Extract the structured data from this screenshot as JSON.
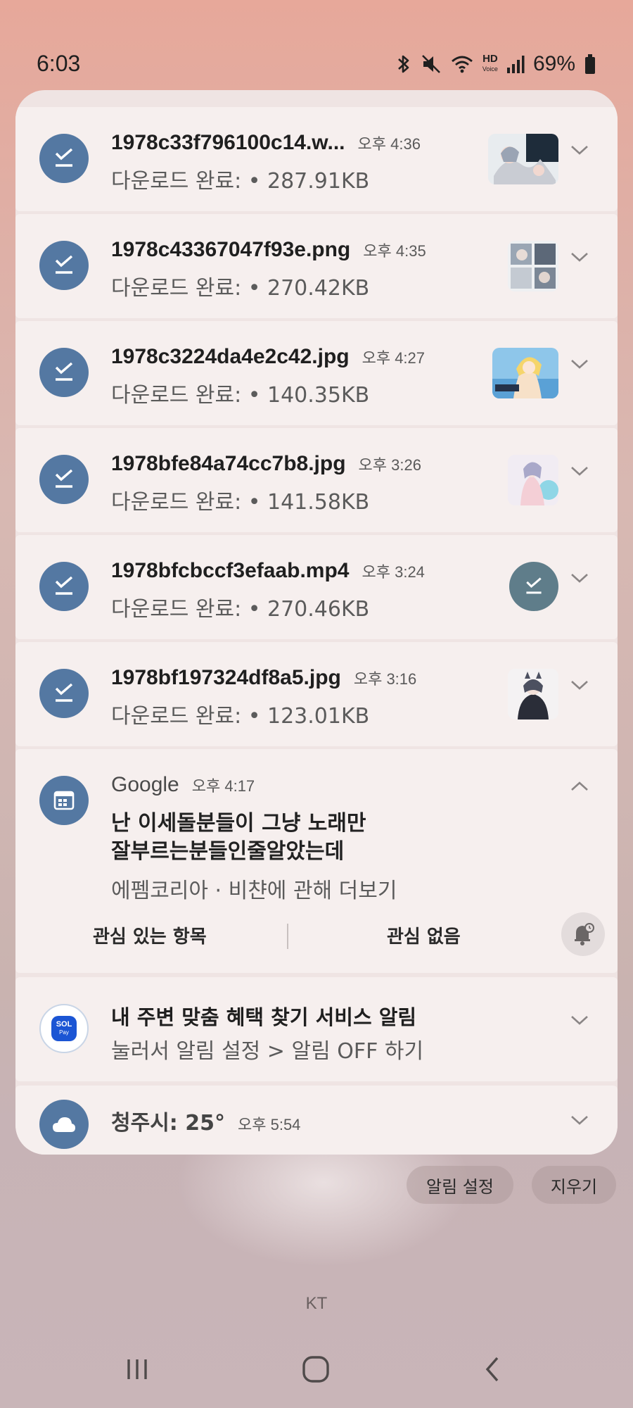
{
  "status_bar": {
    "time": "6:03",
    "battery_percent": "69%",
    "hd_label": "HD",
    "hd_sub": "Voice",
    "icons": [
      "bluetooth-icon",
      "mute-icon",
      "wifi-icon",
      "hd-voice-icon",
      "signal-icon",
      "battery-icon"
    ]
  },
  "downloads": [
    {
      "title": "1978c33f796100c14.w...",
      "time": "오후 4:36",
      "status": "다운로드 완료: • 287.91KB",
      "thumb": "manga-image"
    },
    {
      "title": "1978c43367047f93e.png",
      "time": "오후 4:35",
      "status": "다운로드 완료: • 270.42KB",
      "thumb": "manga-image"
    },
    {
      "title": "1978c3224da4e2c42.jpg",
      "time": "오후 4:27",
      "status": "다운로드 완료: • 140.35KB",
      "thumb": "game-art-image"
    },
    {
      "title": "1978bfe84a74cc7b8.jpg",
      "time": "오후 3:26",
      "status": "다운로드 완료: • 141.58KB",
      "thumb": "anime-image"
    },
    {
      "title": "1978bfcbccf3efaab.mp4",
      "time": "오후 3:24",
      "status": "다운로드 완료: • 270.46KB",
      "thumb": "download-done-icon"
    },
    {
      "title": "1978bf197324df8a5.jpg",
      "time": "오후 3:16",
      "status": "다운로드 완료: • 123.01KB",
      "thumb": "anime-image"
    }
  ],
  "google": {
    "app": "Google",
    "time": "오후 4:17",
    "line1": "난 이세돌분들이 그냥 노래만",
    "line2": "잘부르는분들인줄알았는데",
    "source": "에펨코리아 · 비챤에 관해 더보기",
    "action_interested": "관심 있는 항목",
    "action_not_interested": "관심 없음"
  },
  "sol": {
    "icon_text": "SOL",
    "icon_sub": "Pay",
    "title": "내 주변 맞춤 혜택 찾기 서비스 알림",
    "body": "눌러서 알림 설정 > 알림 OFF 하기"
  },
  "weather": {
    "title": "청주시: 25°",
    "time": "오후 5:54"
  },
  "buttons": {
    "settings": "알림 설정",
    "clear": "지우기"
  },
  "carrier": "KT",
  "colors": {
    "accent_blue": "#5478a2",
    "card": "#f6efee",
    "teal_icon": "#5f7d8a"
  }
}
